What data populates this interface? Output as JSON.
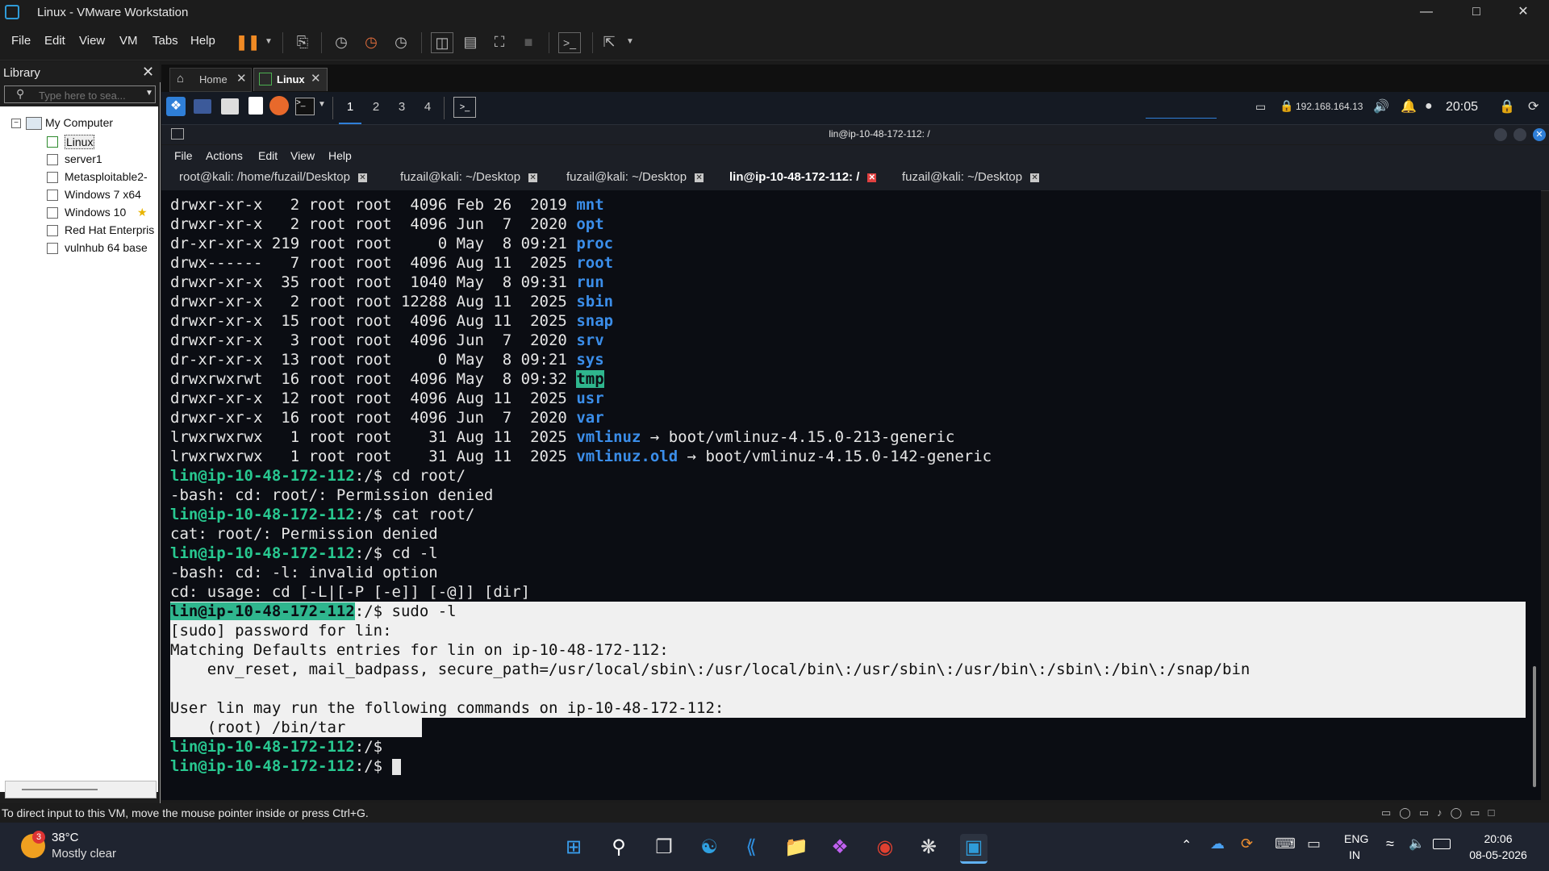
{
  "window": {
    "title": "Linux - VMware Workstation",
    "min_icon": "minimize-icon",
    "max_icon": "maximize-icon",
    "close_icon": "close-icon"
  },
  "menu": [
    "File",
    "Edit",
    "View",
    "VM",
    "Tabs",
    "Help"
  ],
  "library": {
    "title": "Library",
    "search_placeholder": "Type here to sea...",
    "root": "My Computer",
    "items": [
      "Linux",
      "server1",
      "Metasploitable2-",
      "Windows 7 x64",
      "Windows 10",
      "Red Hat Enterpris",
      "vulnhub 64 base"
    ]
  },
  "vm_tabs": [
    {
      "label": "Home"
    },
    {
      "label": "Linux"
    }
  ],
  "kali_panel": {
    "workspaces": [
      "1",
      "2",
      "3",
      "4"
    ],
    "ip": "192.168.164.13",
    "clock": "20:05"
  },
  "terminal": {
    "window_title": "lin@ip-10-48-172-112: /",
    "menu": [
      "File",
      "Actions",
      "Edit",
      "View",
      "Help"
    ],
    "tabs": [
      "root@kali: /home/fuzail/Desktop",
      "fuzail@kali: ~/Desktop",
      "fuzail@kali: ~/Desktop",
      "lin@ip-10-48-172-112: /",
      "fuzail@kali: ~/Desktop"
    ],
    "listing": [
      {
        "perm": "drwxr-xr-x ",
        "links": "  2",
        "size": " 4096",
        "date": "Feb 26  2019",
        "name": "mnt"
      },
      {
        "perm": "drwxr-xr-x ",
        "links": "  2",
        "size": " 4096",
        "date": "Jun  7  2020",
        "name": "opt"
      },
      {
        "perm": "dr-xr-xr-x ",
        "links": "219",
        "size": "    0",
        "date": "May  8 09:21",
        "name": "proc"
      },
      {
        "perm": "drwx------ ",
        "links": "  7",
        "size": " 4096",
        "date": "Aug 11  2025",
        "name": "root"
      },
      {
        "perm": "drwxr-xr-x ",
        "links": " 35",
        "size": " 1040",
        "date": "May  8 09:31",
        "name": "run"
      },
      {
        "perm": "drwxr-xr-x ",
        "links": "  2",
        "size": "12288",
        "date": "Aug 11  2025",
        "name": "sbin"
      },
      {
        "perm": "drwxr-xr-x ",
        "links": " 15",
        "size": " 4096",
        "date": "Aug 11  2025",
        "name": "snap"
      },
      {
        "perm": "drwxr-xr-x ",
        "links": "  3",
        "size": " 4096",
        "date": "Jun  7  2020",
        "name": "srv"
      },
      {
        "perm": "dr-xr-xr-x ",
        "links": " 13",
        "size": "    0",
        "date": "May  8 09:21",
        "name": "sys"
      },
      {
        "perm": "drwxrwxrwt ",
        "links": " 16",
        "size": " 4096",
        "date": "May  8 09:32",
        "name": "tmp"
      },
      {
        "perm": "drwxr-xr-x ",
        "links": " 12",
        "size": " 4096",
        "date": "Aug 11  2025",
        "name": "usr"
      },
      {
        "perm": "drwxr-xr-x ",
        "links": " 16",
        "size": " 4096",
        "date": "Jun  7  2020",
        "name": "var"
      },
      {
        "perm": "lrwxrwxrwx ",
        "links": "  1",
        "size": "   31",
        "date": "Aug 11  2025",
        "name": "vmlinuz",
        "target": " → boot/vmlinuz-4.15.0-213-generic"
      },
      {
        "perm": "lrwxrwxrwx ",
        "links": "  1",
        "size": "   31",
        "date": "Aug 11  2025",
        "name": "vmlinuz.old",
        "target": " → boot/vmlinuz-4.15.0-142-generic"
      }
    ],
    "owner": " root root ",
    "prompt_user": "lin@ip-10-48-172-112",
    "prompt_path": ":/$ ",
    "session": [
      {
        "type": "cmd",
        "text": "cd root/"
      },
      {
        "type": "out",
        "text": "-bash: cd: root/: Permission denied"
      },
      {
        "type": "cmd",
        "text": "cat root/"
      },
      {
        "type": "out",
        "text": "cat: root/: Permission denied"
      },
      {
        "type": "cmd",
        "text": "cd -l"
      },
      {
        "type": "out",
        "text": "-bash: cd: -l: invalid option"
      },
      {
        "type": "out",
        "text": "cd: usage: cd [-L|[-P [-e]] [-@]] [dir]"
      },
      {
        "type": "cmd",
        "text": "sudo -l"
      },
      {
        "type": "out",
        "text": "[sudo] password for lin:"
      },
      {
        "type": "out",
        "text": "Matching Defaults entries for lin on ip-10-48-172-112:"
      },
      {
        "type": "out",
        "text": "    env_reset, mail_badpass, secure_path=/usr/local/sbin\\:/usr/local/bin\\:/usr/sbin\\:/usr/bin\\:/sbin\\:/bin\\:/snap/bin"
      },
      {
        "type": "out",
        "text": ""
      },
      {
        "type": "out",
        "text": "User lin may run the following commands on ip-10-48-172-112:"
      },
      {
        "type": "out",
        "text": "    (root) /bin/tar"
      },
      {
        "type": "cmd",
        "text": ""
      },
      {
        "type": "cmd",
        "text": ""
      }
    ]
  },
  "status": {
    "text": "To direct input to this VM, move the mouse pointer inside or press Ctrl+G."
  },
  "taskbar": {
    "weather_temp": "38°C",
    "weather_desc": "Mostly clear",
    "badge": "3",
    "lang_top": "ENG",
    "lang_bottom": "IN",
    "time": "20:06",
    "date": "08-05-2026"
  },
  "colors": {
    "dir": "#3b8eea",
    "prompt": "#28c890",
    "terminal_bg": "#0b0d13",
    "accent": "#2f9bd8"
  }
}
